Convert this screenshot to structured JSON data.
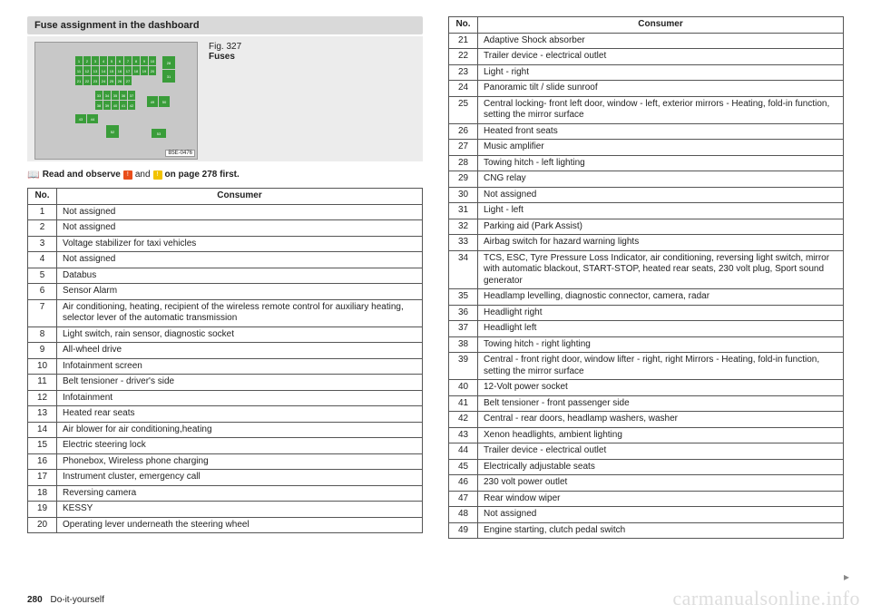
{
  "section_title": "Fuse assignment in the dashboard",
  "figure": {
    "number": "Fig. 327",
    "title": "Fuses",
    "code": "B5E-0476"
  },
  "read_observe": {
    "prefix": "Read and observe",
    "and": "and",
    "suffix": "on page 278 first."
  },
  "table_headers": {
    "no": "No.",
    "consumer": "Consumer"
  },
  "left_rows": [
    {
      "no": "1",
      "c": "Not assigned"
    },
    {
      "no": "2",
      "c": "Not assigned"
    },
    {
      "no": "3",
      "c": "Voltage stabilizer for taxi vehicles"
    },
    {
      "no": "4",
      "c": "Not assigned"
    },
    {
      "no": "5",
      "c": "Databus"
    },
    {
      "no": "6",
      "c": "Sensor Alarm"
    },
    {
      "no": "7",
      "c": "Air conditioning, heating, recipient of the wireless remote control for auxiliary heating, selector lever of the automatic transmission"
    },
    {
      "no": "8",
      "c": "Light switch, rain sensor, diagnostic socket"
    },
    {
      "no": "9",
      "c": "All-wheel drive"
    },
    {
      "no": "10",
      "c": "Infotainment screen"
    },
    {
      "no": "11",
      "c": "Belt tensioner - driver's side"
    },
    {
      "no": "12",
      "c": "Infotainment"
    },
    {
      "no": "13",
      "c": "Heated rear seats"
    },
    {
      "no": "14",
      "c": "Air blower for air conditioning,heating"
    },
    {
      "no": "15",
      "c": "Electric steering lock"
    },
    {
      "no": "16",
      "c": "Phonebox, Wireless phone charging"
    },
    {
      "no": "17",
      "c": "Instrument cluster, emergency call"
    },
    {
      "no": "18",
      "c": "Reversing camera"
    },
    {
      "no": "19",
      "c": "KESSY"
    },
    {
      "no": "20",
      "c": "Operating lever underneath the steering wheel"
    }
  ],
  "right_rows": [
    {
      "no": "21",
      "c": "Adaptive Shock absorber"
    },
    {
      "no": "22",
      "c": "Trailer device - electrical outlet"
    },
    {
      "no": "23",
      "c": "Light - right"
    },
    {
      "no": "24",
      "c": "Panoramic tilt / slide sunroof"
    },
    {
      "no": "25",
      "c": "Central locking- front left door, window - left, exterior mirrors - Heating, fold-in function, setting the mirror surface"
    },
    {
      "no": "26",
      "c": "Heated front seats"
    },
    {
      "no": "27",
      "c": "Music amplifier"
    },
    {
      "no": "28",
      "c": "Towing hitch - left lighting"
    },
    {
      "no": "29",
      "c": "CNG relay"
    },
    {
      "no": "30",
      "c": "Not assigned"
    },
    {
      "no": "31",
      "c": "Light - left"
    },
    {
      "no": "32",
      "c": "Parking aid (Park Assist)"
    },
    {
      "no": "33",
      "c": "Airbag switch for hazard warning lights"
    },
    {
      "no": "34",
      "c": "TCS, ESC, Tyre Pressure Loss Indicator, air conditioning, reversing light switch, mirror with automatic blackout, START-STOP, heated rear seats, 230 volt plug, Sport sound generator"
    },
    {
      "no": "35",
      "c": "Headlamp levelling, diagnostic connector, camera, radar"
    },
    {
      "no": "36",
      "c": "Headlight right"
    },
    {
      "no": "37",
      "c": "Headlight left"
    },
    {
      "no": "38",
      "c": "Towing hitch - right lighting"
    },
    {
      "no": "39",
      "c": "Central - front right door, window lifter - right, right Mirrors - Heating, fold-in function, setting the mirror surface"
    },
    {
      "no": "40",
      "c": "12-Volt power socket"
    },
    {
      "no": "41",
      "c": "Belt tensioner - front passenger side"
    },
    {
      "no": "42",
      "c": "Central - rear doors, headlamp washers, washer"
    },
    {
      "no": "43",
      "c": "Xenon headlights, ambient lighting"
    },
    {
      "no": "44",
      "c": "Trailer device - electrical outlet"
    },
    {
      "no": "45",
      "c": "Electrically adjustable seats"
    },
    {
      "no": "46",
      "c": "230 volt power outlet"
    },
    {
      "no": "47",
      "c": "Rear window wiper"
    },
    {
      "no": "48",
      "c": "Not assigned"
    },
    {
      "no": "49",
      "c": "Engine starting, clutch pedal switch"
    }
  ],
  "footer": {
    "page": "280",
    "section": "Do-it-yourself"
  },
  "watermark": "carmanualsonline.info",
  "continue_marker": "▸"
}
